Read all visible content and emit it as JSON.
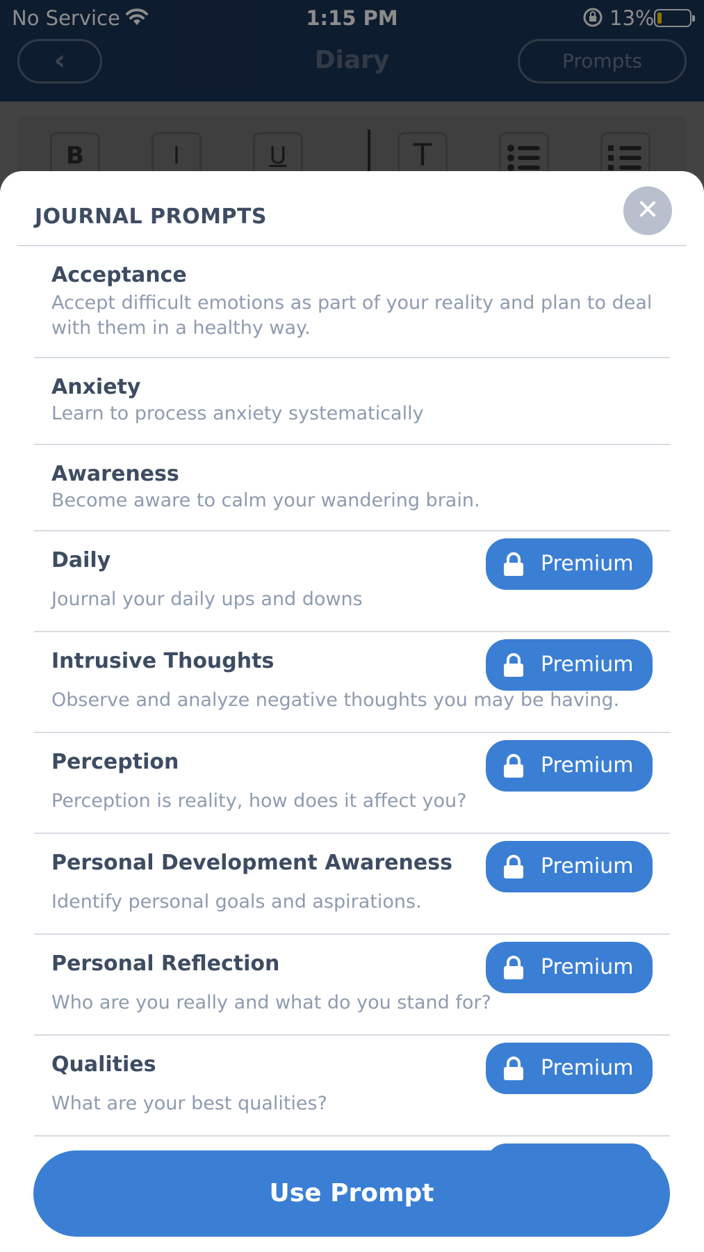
{
  "status_bar": {
    "carrier": "No Service",
    "time": "1:15 PM",
    "battery_pct": "13%",
    "battery_level": 0.13,
    "wifi_icon": "wifi-icon",
    "lock_icon": "orientation-lock-icon",
    "battery_color": "#ffd60a"
  },
  "nav": {
    "back_icon": "chevron-left-icon",
    "back_glyph": "‹",
    "title": "Diary",
    "prompts_label": "Prompts"
  },
  "toolbar": {
    "bold": "B",
    "italic": "I",
    "underline": "U",
    "text_size": "T",
    "bullet_list_icon": "bullet-list-icon",
    "numbered_list_icon": "numbered-list-icon"
  },
  "modal": {
    "title": "JOURNAL PROMPTS",
    "close_glyph": "✕",
    "premium_label": "Premium",
    "use_prompt_label": "Use Prompt",
    "accent_color": "#3b7fd4",
    "items": [
      {
        "title": "Acceptance",
        "desc": "Accept difficult emotions as part of your reality and plan to deal with them in a healthy way.",
        "premium": false
      },
      {
        "title": "Anxiety",
        "desc": "Learn to process anxiety systematically",
        "premium": false
      },
      {
        "title": "Awareness",
        "desc": "Become aware to calm your wandering brain.",
        "premium": false
      },
      {
        "title": "Daily",
        "desc": "Journal your daily ups and downs",
        "premium": true
      },
      {
        "title": "Intrusive Thoughts",
        "desc": "Observe and analyze negative thoughts you may be having.",
        "premium": true
      },
      {
        "title": "Perception",
        "desc": "Perception is reality, how does it affect you?",
        "premium": true
      },
      {
        "title": "Personal Development Awareness",
        "desc": "Identify personal goals and aspirations.",
        "premium": true
      },
      {
        "title": "Personal Reflection",
        "desc": "Who are you really and what do you stand for?",
        "premium": true
      },
      {
        "title": "Qualities",
        "desc": "What are your best qualities?",
        "premium": true
      }
    ]
  }
}
